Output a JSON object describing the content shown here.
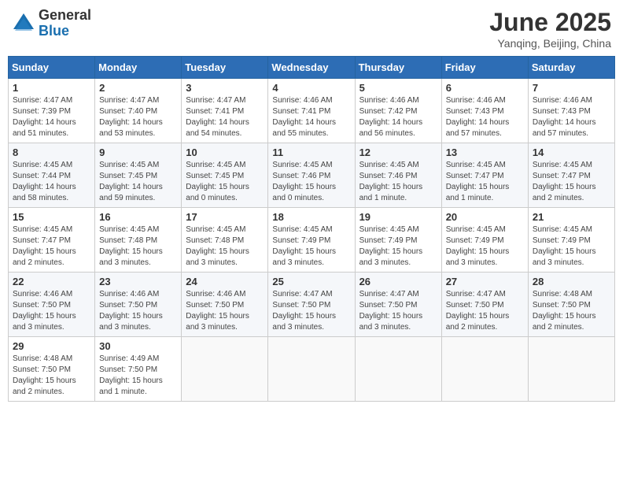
{
  "header": {
    "logo_general": "General",
    "logo_blue": "Blue",
    "month": "June 2025",
    "location": "Yanqing, Beijing, China"
  },
  "weekdays": [
    "Sunday",
    "Monday",
    "Tuesday",
    "Wednesday",
    "Thursday",
    "Friday",
    "Saturday"
  ],
  "weeks": [
    [
      {
        "day": 1,
        "info": "Sunrise: 4:47 AM\nSunset: 7:39 PM\nDaylight: 14 hours\nand 51 minutes."
      },
      {
        "day": 2,
        "info": "Sunrise: 4:47 AM\nSunset: 7:40 PM\nDaylight: 14 hours\nand 53 minutes."
      },
      {
        "day": 3,
        "info": "Sunrise: 4:47 AM\nSunset: 7:41 PM\nDaylight: 14 hours\nand 54 minutes."
      },
      {
        "day": 4,
        "info": "Sunrise: 4:46 AM\nSunset: 7:41 PM\nDaylight: 14 hours\nand 55 minutes."
      },
      {
        "day": 5,
        "info": "Sunrise: 4:46 AM\nSunset: 7:42 PM\nDaylight: 14 hours\nand 56 minutes."
      },
      {
        "day": 6,
        "info": "Sunrise: 4:46 AM\nSunset: 7:43 PM\nDaylight: 14 hours\nand 57 minutes."
      },
      {
        "day": 7,
        "info": "Sunrise: 4:46 AM\nSunset: 7:43 PM\nDaylight: 14 hours\nand 57 minutes."
      }
    ],
    [
      {
        "day": 8,
        "info": "Sunrise: 4:45 AM\nSunset: 7:44 PM\nDaylight: 14 hours\nand 58 minutes."
      },
      {
        "day": 9,
        "info": "Sunrise: 4:45 AM\nSunset: 7:45 PM\nDaylight: 14 hours\nand 59 minutes."
      },
      {
        "day": 10,
        "info": "Sunrise: 4:45 AM\nSunset: 7:45 PM\nDaylight: 15 hours\nand 0 minutes."
      },
      {
        "day": 11,
        "info": "Sunrise: 4:45 AM\nSunset: 7:46 PM\nDaylight: 15 hours\nand 0 minutes."
      },
      {
        "day": 12,
        "info": "Sunrise: 4:45 AM\nSunset: 7:46 PM\nDaylight: 15 hours\nand 1 minute."
      },
      {
        "day": 13,
        "info": "Sunrise: 4:45 AM\nSunset: 7:47 PM\nDaylight: 15 hours\nand 1 minute."
      },
      {
        "day": 14,
        "info": "Sunrise: 4:45 AM\nSunset: 7:47 PM\nDaylight: 15 hours\nand 2 minutes."
      }
    ],
    [
      {
        "day": 15,
        "info": "Sunrise: 4:45 AM\nSunset: 7:47 PM\nDaylight: 15 hours\nand 2 minutes."
      },
      {
        "day": 16,
        "info": "Sunrise: 4:45 AM\nSunset: 7:48 PM\nDaylight: 15 hours\nand 3 minutes."
      },
      {
        "day": 17,
        "info": "Sunrise: 4:45 AM\nSunset: 7:48 PM\nDaylight: 15 hours\nand 3 minutes."
      },
      {
        "day": 18,
        "info": "Sunrise: 4:45 AM\nSunset: 7:49 PM\nDaylight: 15 hours\nand 3 minutes."
      },
      {
        "day": 19,
        "info": "Sunrise: 4:45 AM\nSunset: 7:49 PM\nDaylight: 15 hours\nand 3 minutes."
      },
      {
        "day": 20,
        "info": "Sunrise: 4:45 AM\nSunset: 7:49 PM\nDaylight: 15 hours\nand 3 minutes."
      },
      {
        "day": 21,
        "info": "Sunrise: 4:45 AM\nSunset: 7:49 PM\nDaylight: 15 hours\nand 3 minutes."
      }
    ],
    [
      {
        "day": 22,
        "info": "Sunrise: 4:46 AM\nSunset: 7:50 PM\nDaylight: 15 hours\nand 3 minutes."
      },
      {
        "day": 23,
        "info": "Sunrise: 4:46 AM\nSunset: 7:50 PM\nDaylight: 15 hours\nand 3 minutes."
      },
      {
        "day": 24,
        "info": "Sunrise: 4:46 AM\nSunset: 7:50 PM\nDaylight: 15 hours\nand 3 minutes."
      },
      {
        "day": 25,
        "info": "Sunrise: 4:47 AM\nSunset: 7:50 PM\nDaylight: 15 hours\nand 3 minutes."
      },
      {
        "day": 26,
        "info": "Sunrise: 4:47 AM\nSunset: 7:50 PM\nDaylight: 15 hours\nand 3 minutes."
      },
      {
        "day": 27,
        "info": "Sunrise: 4:47 AM\nSunset: 7:50 PM\nDaylight: 15 hours\nand 2 minutes."
      },
      {
        "day": 28,
        "info": "Sunrise: 4:48 AM\nSunset: 7:50 PM\nDaylight: 15 hours\nand 2 minutes."
      }
    ],
    [
      {
        "day": 29,
        "info": "Sunrise: 4:48 AM\nSunset: 7:50 PM\nDaylight: 15 hours\nand 2 minutes."
      },
      {
        "day": 30,
        "info": "Sunrise: 4:49 AM\nSunset: 7:50 PM\nDaylight: 15 hours\nand 1 minute."
      },
      null,
      null,
      null,
      null,
      null
    ]
  ]
}
